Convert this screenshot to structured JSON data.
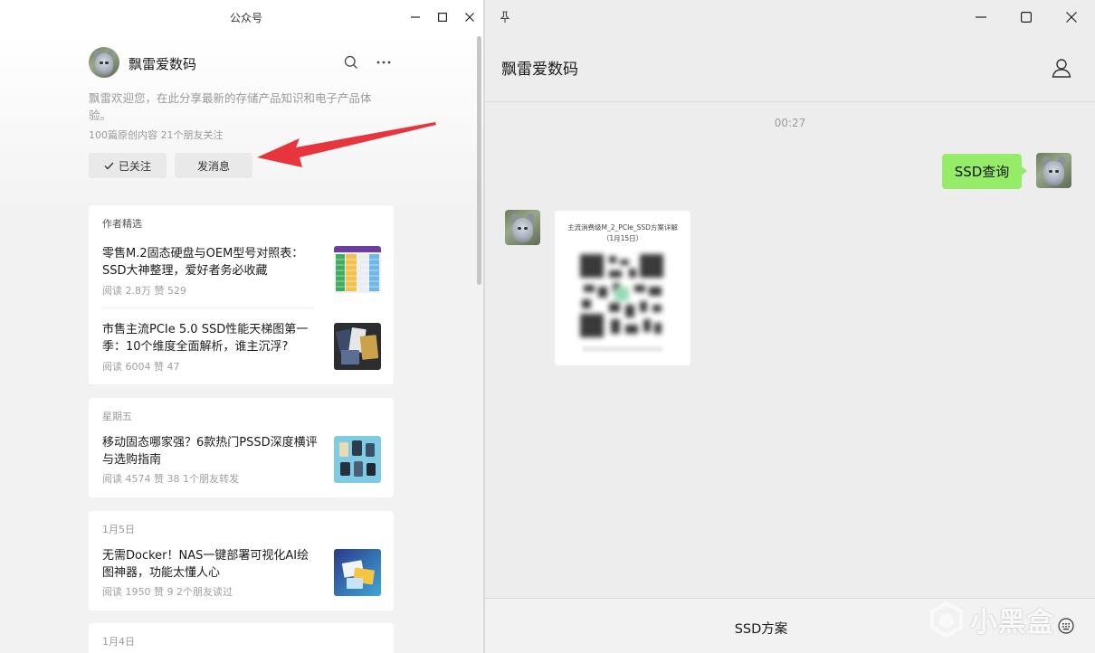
{
  "left_window": {
    "title": "公众号",
    "account": {
      "name": "飘雷爱数码",
      "description": "飘雷欢迎您，在此分享最新的存储产品知识和电子产品体验。",
      "stats": "100篇原创内容 21个朋友关注"
    },
    "buttons": {
      "followed_label": "已关注",
      "message_label": "发消息"
    },
    "featured": {
      "label": "作者精选",
      "articles": [
        {
          "title": "零售M.2固态硬盘与OEM型号对照表：SSD大神整理，爱好者务必收藏",
          "meta": "阅读 2.8万  赞 529"
        },
        {
          "title": "市售主流PCIe 5.0 SSD性能天梯图第一季：10个维度全面解析，谁主沉浮?",
          "meta": "阅读 6004  赞 47"
        }
      ]
    },
    "posts": [
      {
        "date": "星期五",
        "title": "移动固态哪家强？6款热门PSSD深度横评与选购指南",
        "meta": "阅读 4574  赞 38  1个朋友转发"
      },
      {
        "date": "1月5日",
        "title": "无需Docker！NAS一键部署可视化AI绘图神器，功能太懂人心",
        "meta": "阅读 1950  赞 9  2个朋友读过"
      },
      {
        "date": "1月4日"
      }
    ]
  },
  "right_window": {
    "chat_name": "飘雷爱数码",
    "timestamp": "00:27",
    "sent_message": "SSD查询",
    "image_card_title": "主流消费级M_2_PCIe_SSD方案详解（1月15日）",
    "input_menu_label": "SSD方案"
  },
  "watermark": "小黑盒",
  "colors": {
    "bubble_green": "#95ec69",
    "arrow_red": "#e8343c",
    "window_bg": "#ededed"
  }
}
